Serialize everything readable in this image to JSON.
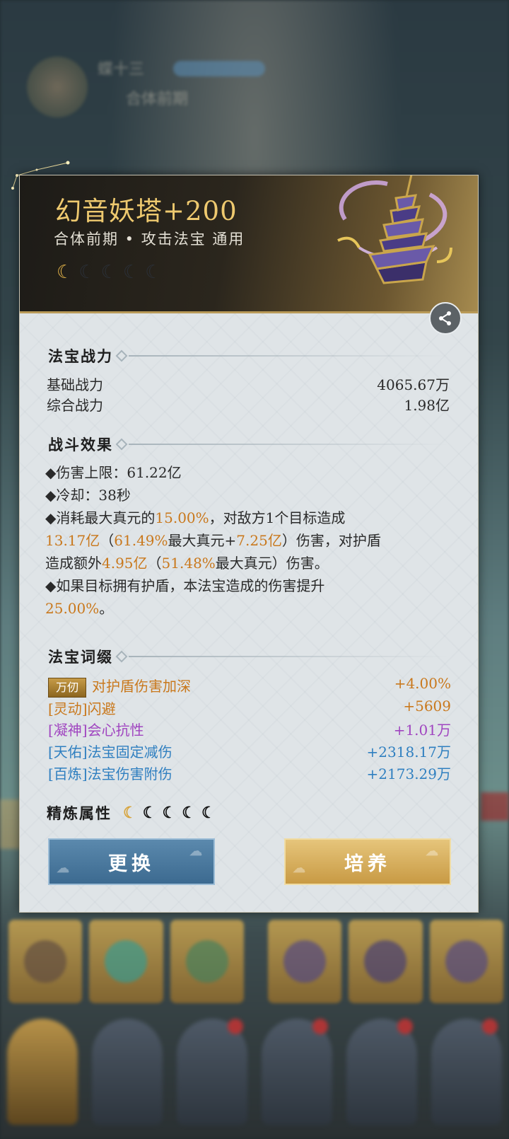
{
  "background": {
    "player_name": "蝶十三",
    "sub_text": "合体前期"
  },
  "item": {
    "title": "幻音妖塔+200",
    "subtitle": "合体前期 • 攻击法宝 通用",
    "moon_count_lit": 1,
    "moon_count_total": 5,
    "accent_color": "#eec96f"
  },
  "power": {
    "section_title": "法宝战力",
    "rows": [
      {
        "label": "基础战力",
        "value": "4065.67万"
      },
      {
        "label": "综合战力",
        "value": "1.98亿"
      }
    ]
  },
  "combat": {
    "section_title": "战斗效果",
    "line1": "◆伤害上限：61.22亿",
    "line2": "◆冷却：38秒",
    "l3_a": "◆消耗最大真元的",
    "l3_b": "15.00%",
    "l3_c": "，对敌方1个目标造成",
    "l4_a": "13.17亿",
    "l4_b": "（",
    "l4_c": "61.49%",
    "l4_d": "最大真元+",
    "l4_e": "7.25亿",
    "l4_f": "）伤害，对护盾",
    "l5_a": "造成额外",
    "l5_b": "4.95亿",
    "l5_c": "（",
    "l5_d": "51.48%",
    "l5_e": "最大真元）伤害。",
    "l6": "◆如果目标拥有护盾，本法宝造成的伤害提升",
    "l7_a": "25.00%",
    "l7_b": "。"
  },
  "affixes": {
    "section_title": "法宝词缀",
    "items": [
      {
        "badge": "万仞",
        "name": "对护盾伤害加深",
        "value": "+4.00%",
        "color": "#c9781c"
      },
      {
        "name": "[灵动]闪避",
        "value": "+5609",
        "color": "#c9781c"
      },
      {
        "name": "[凝神]会心抗性",
        "value": "+1.01万",
        "color": "#a045c0"
      },
      {
        "name": "[天佑]法宝固定减伤",
        "value": "+2318.17万",
        "color": "#2f7fc0"
      },
      {
        "name": "[百炼]法宝伤害附伤",
        "value": "+2173.29万",
        "color": "#2f7fc0"
      }
    ]
  },
  "refine": {
    "label": "精炼属性"
  },
  "buttons": {
    "swap": "更换",
    "cultivate": "培养"
  },
  "icons": {
    "share": "share-icon",
    "moon": "crescent-moon-icon"
  }
}
